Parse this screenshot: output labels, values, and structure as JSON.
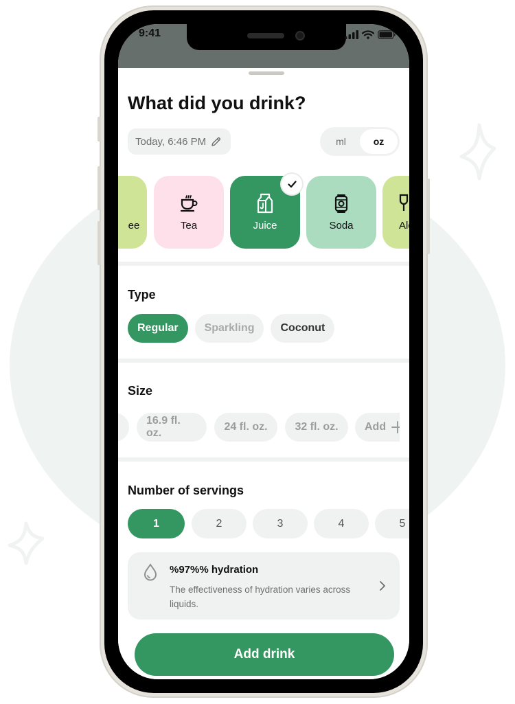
{
  "status_bar": {
    "time": "9:41"
  },
  "sheet": {
    "title": "What did you drink?",
    "datetime": "Today, 6:46  PM",
    "units": [
      {
        "label": "ml",
        "active": false
      },
      {
        "label": "oz",
        "active": true
      }
    ]
  },
  "drinks": [
    {
      "label": "ee",
      "icon": "coffee-icon",
      "color": "#cfe497",
      "selected": false
    },
    {
      "label": "Tea",
      "icon": "tea-cup-icon",
      "color": "#fde0ea",
      "selected": false
    },
    {
      "label": "Juice",
      "icon": "juice-carton-icon",
      "color": "#349761",
      "selected": true
    },
    {
      "label": "Soda",
      "icon": "soda-can-icon",
      "color": "#abdcc0",
      "selected": false
    },
    {
      "label": "Alc",
      "icon": "wine-glass-icon",
      "color": "#cfe497",
      "selected": false
    }
  ],
  "type_section": {
    "label": "Type",
    "options": [
      {
        "label": "Regular",
        "state": "active"
      },
      {
        "label": "Sparkling",
        "state": "disabled"
      },
      {
        "label": "Coconut",
        "state": "normal"
      }
    ]
  },
  "size_section": {
    "label": "Size",
    "options": [
      "16.9 fl. oz.",
      "24 fl. oz.",
      "32 fl. oz."
    ],
    "add_label": "Add"
  },
  "servings_section": {
    "label": "Number of servings",
    "options": [
      "1",
      "2",
      "3",
      "4",
      "5"
    ],
    "selected": "1"
  },
  "hydration_info": {
    "title": "%97%% hydration",
    "description": "The effectiveness of hydration varies across liquids."
  },
  "add_button": {
    "label": "Add drink"
  },
  "colors": {
    "accent": "#349761",
    "chip_bg": "#f0f2f1",
    "status_bg": "#676f6c"
  }
}
